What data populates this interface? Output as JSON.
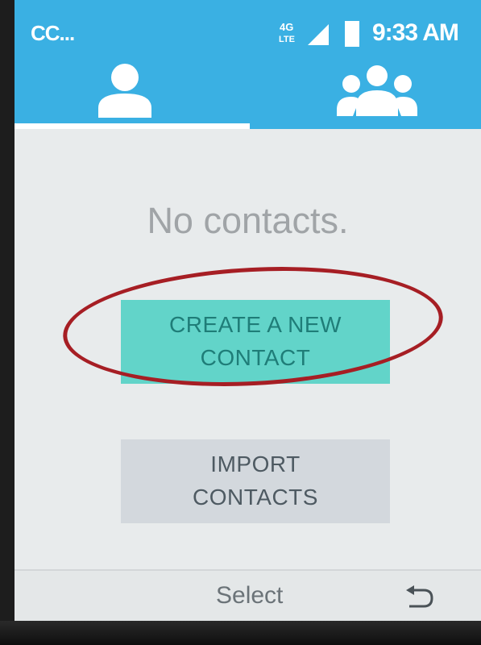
{
  "status_bar": {
    "carrier": "CC...",
    "network_type": "4G LTE",
    "time": "9:33 AM"
  },
  "tabs": [
    {
      "name": "contacts",
      "icon": "person-icon",
      "selected": true
    },
    {
      "name": "groups",
      "icon": "group-icon",
      "selected": false
    }
  ],
  "main": {
    "empty_message": "No contacts.",
    "create_button": "CREATE A NEW\nCONTACT",
    "import_button": "IMPORT\nCONTACTS"
  },
  "softkeys": {
    "center": "Select",
    "right_icon": "back-icon"
  },
  "colors": {
    "header": "#3ab0e3",
    "background": "#e8ebec",
    "create_button_bg": "#62d4c9",
    "create_button_text": "#1f7d78",
    "import_button_bg": "#d3d8dd",
    "highlight_ring": "#a61e24"
  }
}
